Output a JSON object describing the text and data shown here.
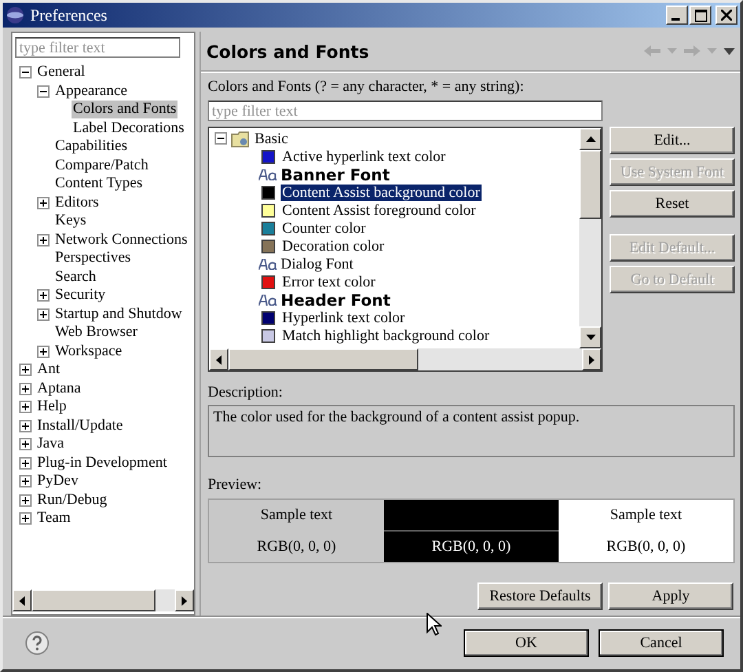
{
  "window": {
    "title": "Preferences"
  },
  "sidebar": {
    "filter": {
      "placeholder": "type filter text"
    },
    "items": [
      {
        "label": "General",
        "expanded": true,
        "selected": false,
        "children": [
          {
            "label": "Appearance",
            "expanded": true,
            "selected": false,
            "children": [
              {
                "label": "Colors and Fonts",
                "selected": true
              },
              {
                "label": "Label Decorations",
                "selected": false
              }
            ]
          },
          {
            "label": "Capabilities",
            "selected": false
          },
          {
            "label": "Compare/Patch",
            "selected": false
          },
          {
            "label": "Content Types",
            "selected": false
          },
          {
            "label": "Editors",
            "expanded": false,
            "selected": false
          },
          {
            "label": "Keys",
            "selected": false
          },
          {
            "label": "Network Connections",
            "expanded": false,
            "selected": false
          },
          {
            "label": "Perspectives",
            "selected": false
          },
          {
            "label": "Search",
            "selected": false
          },
          {
            "label": "Security",
            "expanded": false,
            "selected": false
          },
          {
            "label": "Startup and Shutdow",
            "expanded": false,
            "selected": false
          },
          {
            "label": "Web Browser",
            "selected": false
          },
          {
            "label": "Workspace",
            "expanded": false,
            "selected": false
          }
        ]
      },
      {
        "label": "Ant",
        "expanded": false,
        "selected": false
      },
      {
        "label": "Aptana",
        "expanded": false,
        "selected": false
      },
      {
        "label": "Help",
        "expanded": false,
        "selected": false
      },
      {
        "label": "Install/Update",
        "expanded": false,
        "selected": false
      },
      {
        "label": "Java",
        "expanded": false,
        "selected": false
      },
      {
        "label": "Plug-in Development",
        "expanded": false,
        "selected": false
      },
      {
        "label": "PyDev",
        "expanded": false,
        "selected": false
      },
      {
        "label": "Run/Debug",
        "expanded": false,
        "selected": false
      },
      {
        "label": "Team",
        "expanded": false,
        "selected": false
      }
    ]
  },
  "page": {
    "title": "Colors and Fonts",
    "filter_label": "Colors and Fonts (? = any character, * = any string):",
    "filter": {
      "placeholder": "type filter text"
    },
    "tree": [
      {
        "label": "Basic",
        "kind": "category",
        "expanded": true,
        "selected": false,
        "children": [
          {
            "label": "Active hyperlink text color",
            "kind": "color",
            "color": "#1414c8",
            "selected": false
          },
          {
            "label": "Banner Font",
            "kind": "font-large",
            "selected": false
          },
          {
            "label": "Content Assist background color",
            "kind": "color",
            "color": "#000000",
            "selected": true
          },
          {
            "label": "Content Assist foreground color",
            "kind": "color",
            "color": "#ffff99",
            "selected": false
          },
          {
            "label": "Counter color",
            "kind": "color",
            "color": "#1a7f9a",
            "selected": false
          },
          {
            "label": "Decoration color",
            "kind": "color",
            "color": "#857358",
            "selected": false
          },
          {
            "label": "Dialog Font",
            "kind": "font",
            "selected": false
          },
          {
            "label": "Error text color",
            "kind": "color",
            "color": "#e01010",
            "selected": false
          },
          {
            "label": "Header Font",
            "kind": "font-large",
            "selected": false
          },
          {
            "label": "Hyperlink text color",
            "kind": "color",
            "color": "#000070",
            "selected": false
          },
          {
            "label": "Match highlight background color",
            "kind": "color",
            "color": "#c8c8e4",
            "selected": false
          }
        ]
      }
    ],
    "buttons": [
      {
        "label": "Edit...",
        "disabled": false
      },
      {
        "label": "Use System Font",
        "disabled": true
      },
      {
        "label": "Reset",
        "disabled": false
      },
      {
        "label": "Edit Default...",
        "disabled": true
      },
      {
        "label": "Go to Default",
        "disabled": true
      }
    ],
    "description_label": "Description:",
    "description": "The color used for the background of a content assist popup.",
    "preview_label": "Preview:",
    "preview": [
      {
        "color": "#c8c8c8",
        "sample": "Sample text",
        "rgb": "RGB(0, 0, 0)"
      },
      {
        "color": "#000000",
        "rgb": "RGB(0, 0, 0)"
      },
      {
        "color": "#ffffff",
        "sample": "Sample text",
        "rgb": "RGB(0, 0, 0)"
      }
    ],
    "footer_buttons": [
      {
        "label": "Restore Defaults"
      },
      {
        "label": "Apply"
      }
    ]
  },
  "dialog_buttons": [
    {
      "label": "OK"
    },
    {
      "label": "Cancel"
    }
  ]
}
